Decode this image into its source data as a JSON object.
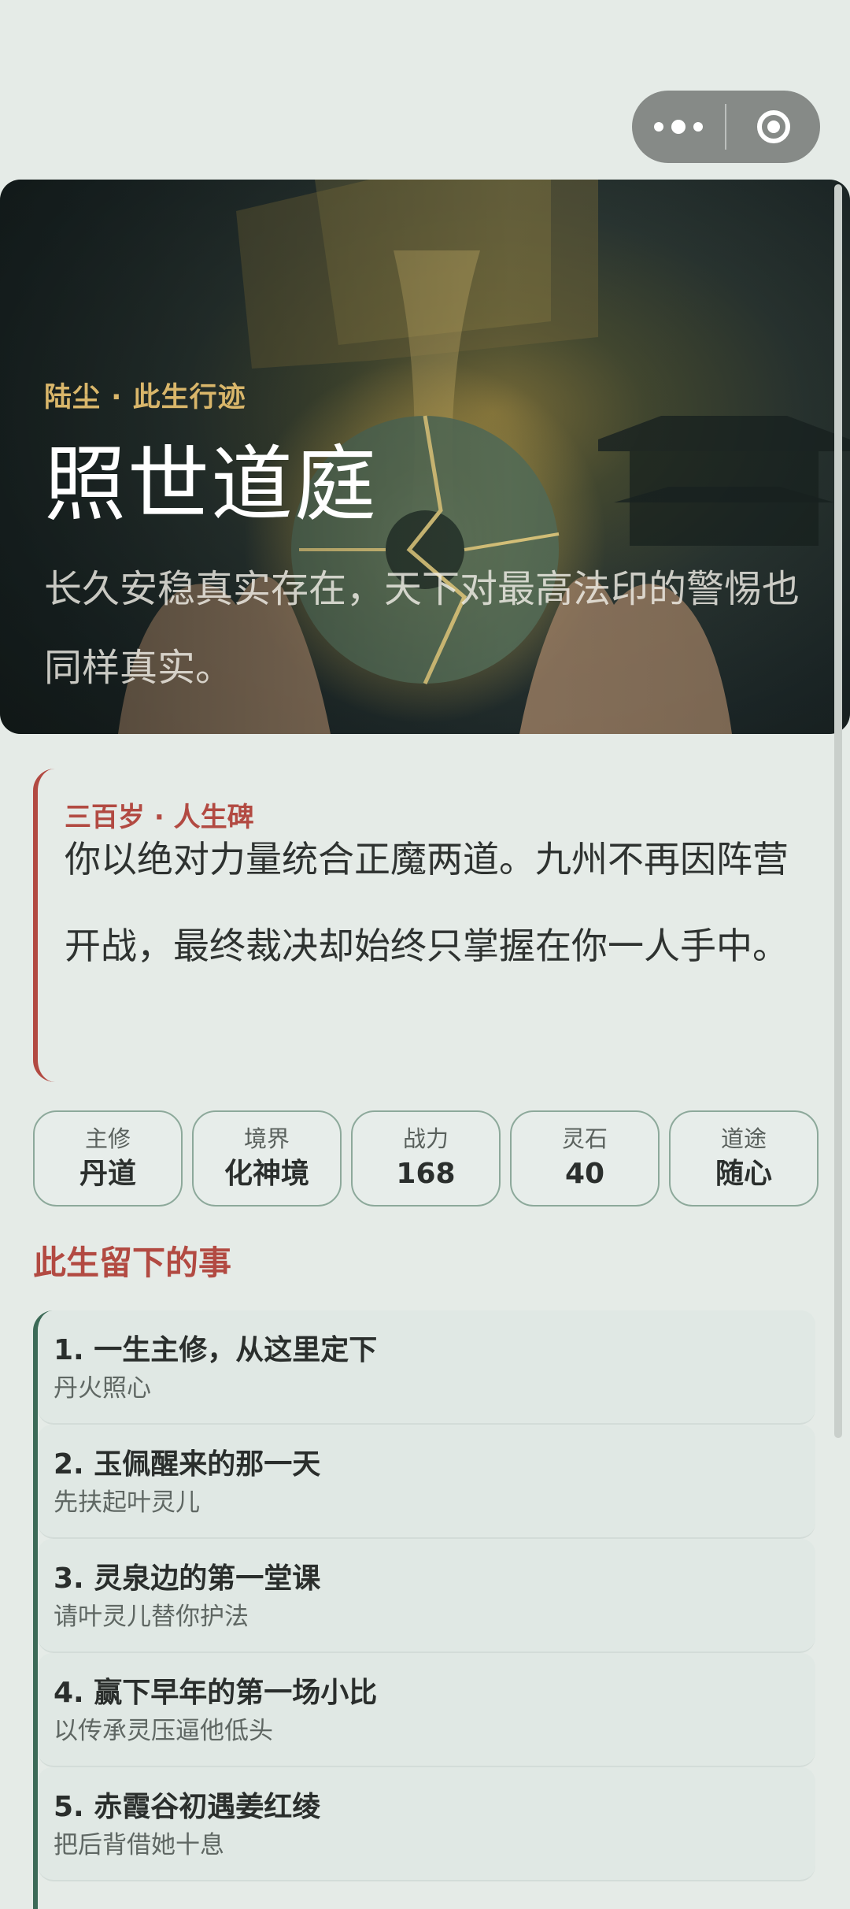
{
  "capsule": {
    "more_icon": "more-dots-icon",
    "close_icon": "target-circle-icon"
  },
  "hero": {
    "kicker": "陆尘 · 此生行迹",
    "title": "照世道庭",
    "subtitle": "长久安稳真实存在，天下对最高法印的警惕也同样真实。"
  },
  "milestone": {
    "label": "三百岁 · 人生碑",
    "text": "你以绝对力量统合正魔两道。九州不再因阵营开战，最终裁决却始终只掌握在你一人手中。"
  },
  "stats": [
    {
      "label": "主修",
      "value": "丹道"
    },
    {
      "label": "境界",
      "value": "化神境"
    },
    {
      "label": "战力",
      "value": "168"
    },
    {
      "label": "灵石",
      "value": "40"
    },
    {
      "label": "道途",
      "value": "随心"
    }
  ],
  "section_title": "此生留下的事",
  "events": [
    {
      "title": "1. 一生主修，从这里定下",
      "subtitle": "丹火照心"
    },
    {
      "title": "2. 玉佩醒来的那一天",
      "subtitle": "先扶起叶灵儿"
    },
    {
      "title": "3. 灵泉边的第一堂课",
      "subtitle": "请叶灵儿替你护法"
    },
    {
      "title": "4. 赢下早年的第一场小比",
      "subtitle": "以传承灵压逼他低头"
    },
    {
      "title": "5. 赤霞谷初遇姜红绫",
      "subtitle": "把后背借她十息"
    }
  ],
  "colors": {
    "accent_red": "#b24a42",
    "accent_green": "#3c6a57",
    "gold": "#d9b66a",
    "background": "#e5ebe7"
  }
}
